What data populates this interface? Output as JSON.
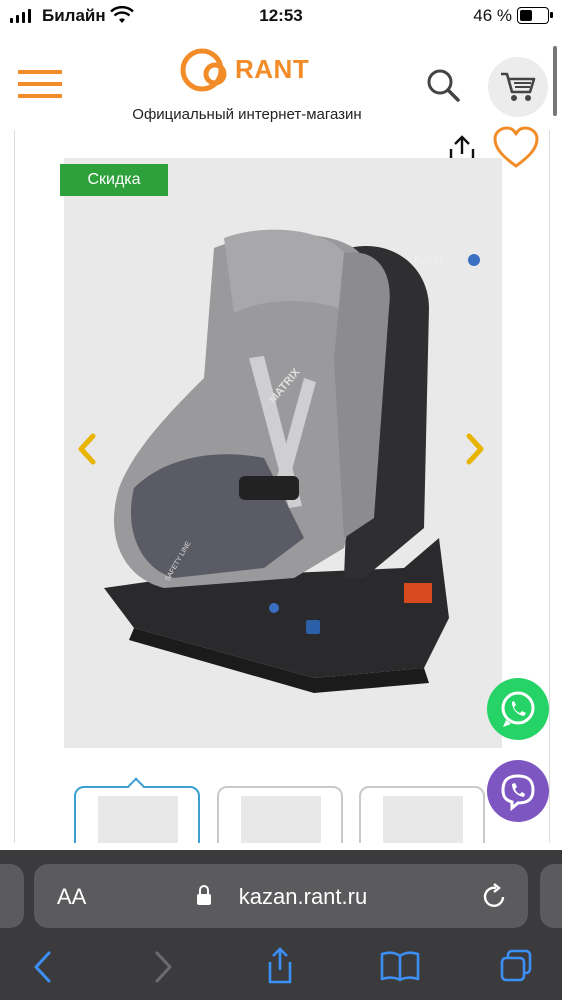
{
  "status_bar": {
    "carrier": "Билайн",
    "time": "12:53",
    "battery": "46 %"
  },
  "header": {
    "logo_text": "RANT",
    "tagline": "Официальный интернет-магазин",
    "menu_icon": "hamburger-icon",
    "search_icon": "search-icon",
    "cart_icon": "cart-icon"
  },
  "product": {
    "discount_badge": "Скидка",
    "share_icon": "share-icon",
    "favorite_icon": "heart-icon",
    "seat_brand": "RANT",
    "seat_model": "MATRIX",
    "seat_label": "SAFETY LINE",
    "image_arrows": [
      "chevron-left-icon",
      "chevron-right-icon"
    ],
    "thumbnails_count": 3,
    "active_thumbnail": 1
  },
  "colors": {
    "brand_orange": "#f28c28",
    "badge_green": "#2fa13a",
    "active_thumb_border": "#3a9fd1",
    "arrow_yellow": "#e8b400",
    "whatsapp_green": "#25d366",
    "viber_purple": "#7d56c2"
  },
  "floating": {
    "whatsapp_icon": "whatsapp-icon",
    "viber_icon": "viber-icon"
  },
  "browser": {
    "text_size_label": "AA",
    "url": "kazan.rant.ru",
    "reload_icon": "reload-icon",
    "lock_icon": "lock-icon",
    "toolbar_icons": [
      "back-icon",
      "forward-icon",
      "share-icon",
      "bookmarks-icon",
      "tabs-icon"
    ]
  }
}
